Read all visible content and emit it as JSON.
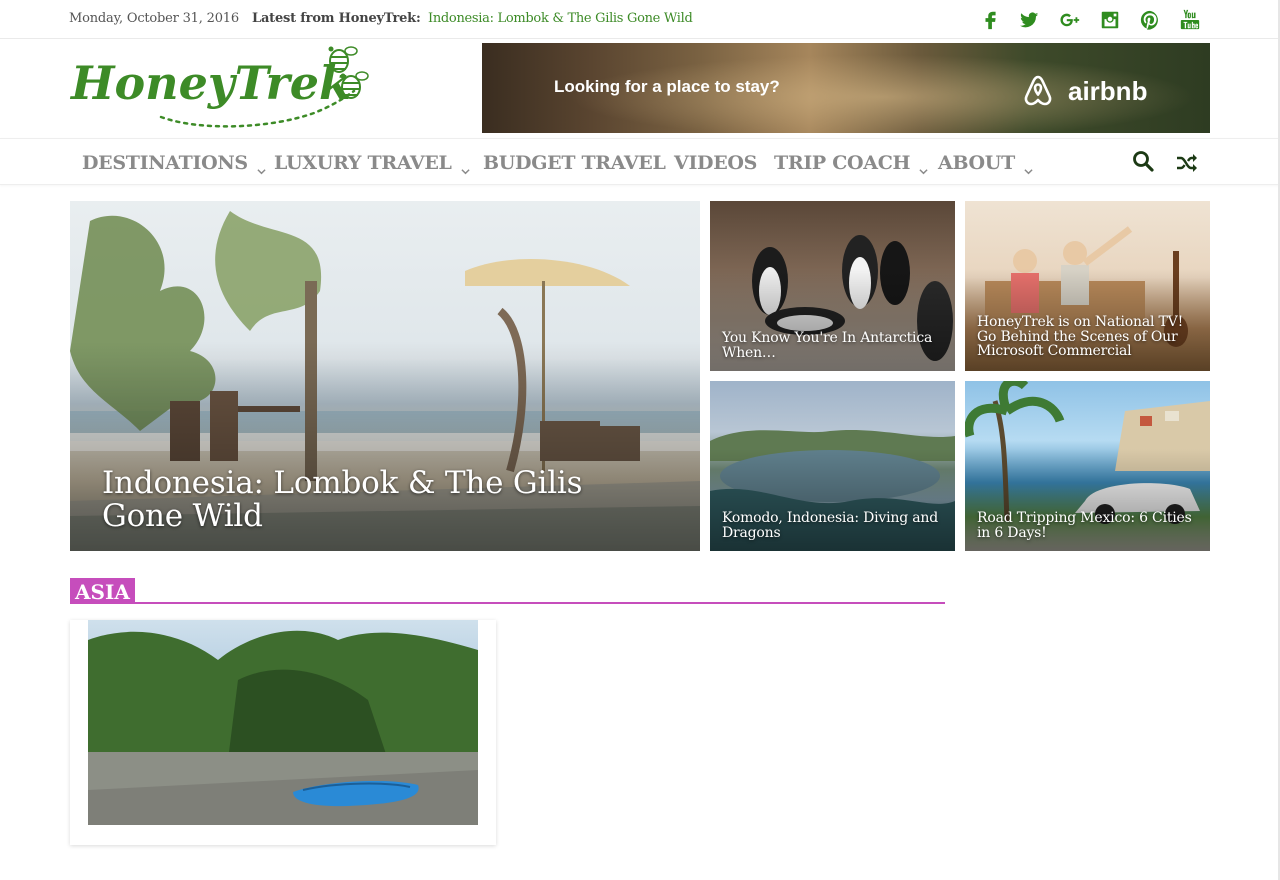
{
  "topbar": {
    "date": "Monday, October 31, 2016",
    "latest_label": "Latest from HoneyTrek:",
    "latest_link": "Indonesia: Lombok & The Gilis Gone Wild",
    "social": [
      "facebook-icon",
      "twitter-icon",
      "google-plus-icon",
      "instagram-icon",
      "pinterest-icon",
      "youtube-icon"
    ]
  },
  "header": {
    "logo_text": "HoneyTrek",
    "ad": {
      "tagline": "Looking for a place to stay?",
      "brand": "airbnb"
    }
  },
  "nav": {
    "items": [
      {
        "label": "DESTINATIONS",
        "has_dropdown": true
      },
      {
        "label": "LUXURY TRAVEL",
        "has_dropdown": true
      },
      {
        "label": "BUDGET TRAVEL",
        "has_dropdown": false
      },
      {
        "label": "VIDEOS",
        "has_dropdown": false
      },
      {
        "label": "TRIP COACH",
        "has_dropdown": true
      },
      {
        "label": "ABOUT",
        "has_dropdown": true
      }
    ]
  },
  "featured": {
    "main": {
      "title": "Indonesia: Lombok & The Gilis Gone Wild"
    },
    "tiles": [
      {
        "title": "You Know You're In Antarctica When…"
      },
      {
        "title": "HoneyTrek is on National TV! Go Behind the Scenes of Our Microsoft Commercial"
      },
      {
        "title": "Komodo, Indonesia: Diving and Dragons"
      },
      {
        "title": "Road Tripping Mexico: 6 Cities in 6 Days!"
      }
    ]
  },
  "section": {
    "title": "ASIA"
  },
  "colors": {
    "brand_green": "#3d8b27",
    "section_accent": "#c64dbc",
    "nav_text": "#8a8a8a"
  }
}
